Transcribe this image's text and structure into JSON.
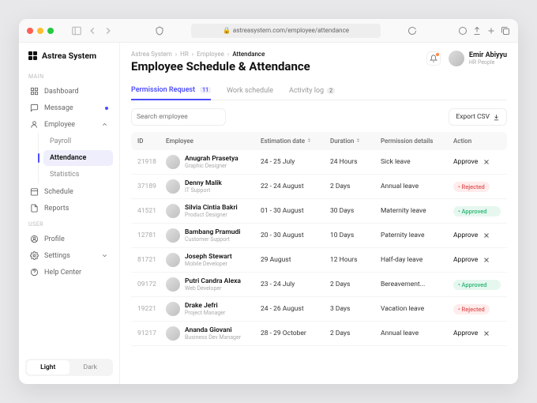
{
  "url": "astreasystem.com/employee/attendance",
  "brand": "Astrea System",
  "sections": {
    "main": "MAIN",
    "user": "USER"
  },
  "nav": {
    "dashboard": "Dashboard",
    "message": "Message",
    "employee": "Employee",
    "payroll": "Payroll",
    "attendance": "Attendance",
    "statistics": "Statistics",
    "schedule": "Schedule",
    "reports": "Reports",
    "profile": "Profile",
    "settings": "Settings",
    "help": "Help Center"
  },
  "theme": {
    "light": "Light",
    "dark": "Dark"
  },
  "breadcrumbs": {
    "a": "Astrea System",
    "b": "HR",
    "c": "Employee",
    "d": "Attendance"
  },
  "page_title": "Employee Schedule & Attendance",
  "user": {
    "name": "Emir Abiyyu",
    "role": "HR People"
  },
  "tabs": {
    "perm": "Permission Request",
    "perm_n": "11",
    "work": "Work schedule",
    "log": "Activity log",
    "log_n": "2"
  },
  "search_placeholder": "Search employee",
  "export": "Export CSV",
  "cols": {
    "id": "ID",
    "emp": "Employee",
    "est": "Estimation date",
    "dur": "Duration",
    "det": "Permission details",
    "act": "Action"
  },
  "actions": {
    "approve": "Approve",
    "rejected": "Rejected",
    "approved": "Approved"
  },
  "rows": [
    {
      "id": "21918",
      "name": "Anugrah Prasetya",
      "role": "Graphic Designer",
      "est": "24 - 25 July",
      "dur": "24 Hours",
      "det": "Sick leave",
      "status": "pending"
    },
    {
      "id": "37189",
      "name": "Denny Malik",
      "role": "IT Support",
      "est": "22 - 24 August",
      "dur": "2 Days",
      "det": "Annual leave",
      "status": "rejected"
    },
    {
      "id": "41521",
      "name": "Silvia Cintia Bakri",
      "role": "Product Designer",
      "est": "01 - 30 August",
      "dur": "30 Days",
      "det": "Maternity leave",
      "status": "approved"
    },
    {
      "id": "12781",
      "name": "Bambang Pramudi",
      "role": "Customer Support",
      "est": "20 - 30 August",
      "dur": "10 Days",
      "det": "Paternity leave",
      "status": "pending"
    },
    {
      "id": "81721",
      "name": "Joseph Stewart",
      "role": "Mobile Developer",
      "est": "29 August",
      "dur": "12 Hours",
      "det": "Half-day leave",
      "status": "pending"
    },
    {
      "id": "09172",
      "name": "Putri Candra Alexa",
      "role": "Web Developer",
      "est": "23 - 24 July",
      "dur": "2 Days",
      "det": "Bereavement...",
      "status": "approved"
    },
    {
      "id": "19221",
      "name": "Drake Jefri",
      "role": "Project Manager",
      "est": "24 - 26 August",
      "dur": "3 Days",
      "det": "Vacation leave",
      "status": "rejected"
    },
    {
      "id": "91217",
      "name": "Ananda Giovani",
      "role": "Business Dev Manager",
      "est": "28 - 29 October",
      "dur": "2 Days",
      "det": "Annual leave",
      "status": "pending"
    }
  ]
}
